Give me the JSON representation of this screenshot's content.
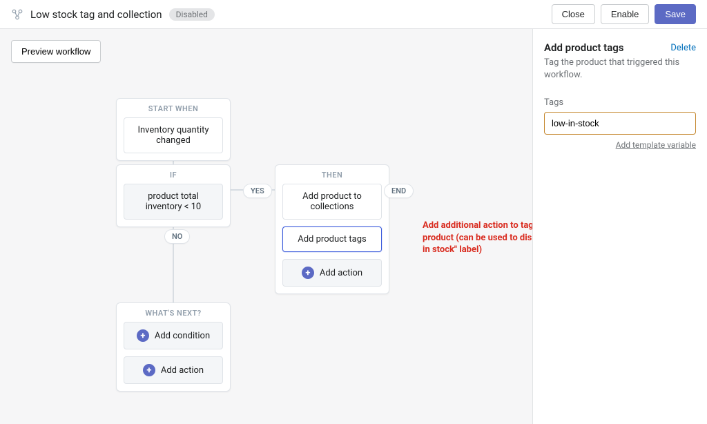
{
  "header": {
    "title": "Low stock tag and collection",
    "status": "Disabled",
    "buttons": {
      "close": "Close",
      "enable": "Enable",
      "save": "Save"
    }
  },
  "canvas": {
    "preview_button": "Preview workflow",
    "start_group": {
      "header": "START WHEN",
      "trigger": "Inventory quantity changed"
    },
    "if_group": {
      "header": "IF",
      "condition": "product total inventory < 10"
    },
    "then_group": {
      "header": "THEN",
      "actions": [
        "Add product to collections",
        "Add product tags"
      ],
      "add_action": "Add action"
    },
    "next_group": {
      "header": "WHAT'S NEXT?",
      "add_condition": "Add condition",
      "add_action": "Add action"
    },
    "pills": {
      "yes": "YES",
      "no": "NO",
      "end": "END"
    }
  },
  "sidebar": {
    "title": "Add product tags",
    "delete": "Delete",
    "description": "Tag the product that triggered this workflow.",
    "tags_label": "Tags",
    "tags_value": "low-in-stock",
    "template_link": "Add template variable"
  },
  "annotation": "Add additional action to tag the product (can be used to display a \"Low in stock\" label)"
}
